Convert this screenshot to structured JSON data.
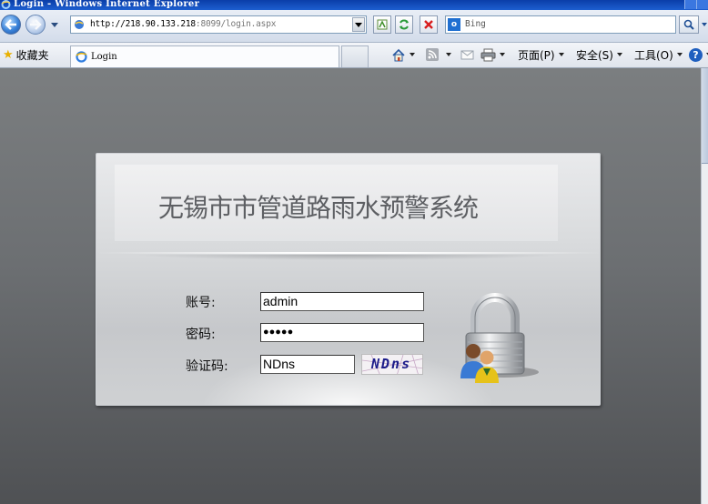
{
  "window": {
    "title": "Login - Windows Internet Explorer"
  },
  "addressbar": {
    "url_host": "http://218.90.133.218",
    "url_rest": ":8099/login.aspx",
    "search_placeholder": "Bing",
    "search_logo": "o"
  },
  "favorites": {
    "label": "收藏夹"
  },
  "tab": {
    "label": "Login"
  },
  "commandbar": {
    "page": "页面(P)",
    "safety": "安全(S)",
    "tools": "工具(O)",
    "help_icon": "?"
  },
  "login": {
    "system_title": "无锡市市管道路雨水预警系统",
    "account_label": "账号:",
    "account_value": "admin",
    "password_label": "密码:",
    "password_value": "●●●●●",
    "captcha_label": "验证码:",
    "captcha_input_value": "NDns",
    "captcha_image_text": "NDns"
  },
  "icons": [
    "ie-icon",
    "back-arrow-icon",
    "forward-arrow-icon",
    "page-icon",
    "compatibility-icon",
    "refresh-icon",
    "stop-icon",
    "search-icon",
    "favorites-star-icon",
    "home-icon",
    "rss-icon",
    "mail-icon",
    "print-icon",
    "help-icon",
    "lock-users-icon"
  ]
}
